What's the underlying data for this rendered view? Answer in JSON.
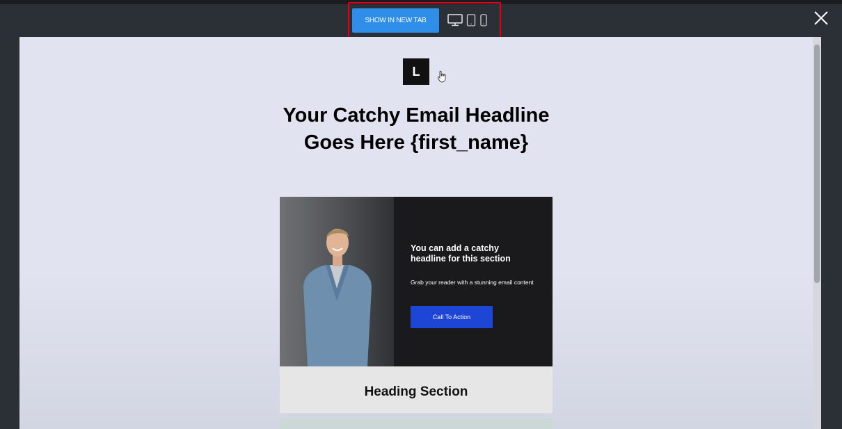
{
  "toolbar": {
    "show_in_new_tab_label": "SHOW IN NEW TAB",
    "devices": [
      "desktop-icon",
      "tablet-icon",
      "mobile-icon"
    ],
    "highlight_color": "#e3001b",
    "button_color": "#2f8ee8"
  },
  "email": {
    "logo_letter": "L",
    "headline": "Your Catchy Email Headline Goes Here {first_name}",
    "hero": {
      "headline": "You can add a catchy headline for this section",
      "body": "Grab your reader with a stunning email content",
      "cta_label": "Call To Action",
      "cta_color": "#1d46d6"
    },
    "heading_section": "Heading Section"
  }
}
